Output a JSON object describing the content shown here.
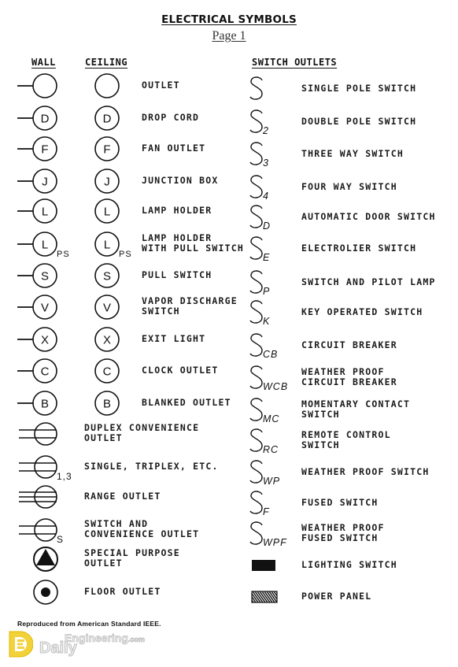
{
  "header": {
    "title": "ELECTRICAL SYMBOLS",
    "subtitle": "Page 1"
  },
  "columns": {
    "wall": "WALL",
    "ceiling": "CEILING",
    "switch_outlets": "SWITCH OUTLETS"
  },
  "outlet_symbols": [
    {
      "letter": "",
      "label": "OUTLET",
      "suffix": ""
    },
    {
      "letter": "D",
      "label": "DROP CORD",
      "suffix": ""
    },
    {
      "letter": "F",
      "label": "FAN OUTLET",
      "suffix": ""
    },
    {
      "letter": "J",
      "label": "JUNCTION BOX",
      "suffix": ""
    },
    {
      "letter": "L",
      "label": "LAMP HOLDER",
      "suffix": ""
    },
    {
      "letter": "L",
      "label": "LAMP HOLDER\nWITH PULL SWITCH",
      "suffix": "PS"
    },
    {
      "letter": "S",
      "label": "PULL SWITCH",
      "suffix": ""
    },
    {
      "letter": "V",
      "label": "VAPOR DISCHARGE\nSWITCH",
      "suffix": ""
    },
    {
      "letter": "X",
      "label": "EXIT LIGHT",
      "suffix": ""
    },
    {
      "letter": "C",
      "label": "CLOCK OUTLET",
      "suffix": ""
    },
    {
      "letter": "B",
      "label": "BLANKED OUTLET",
      "suffix": ""
    }
  ],
  "convenience_symbols": [
    {
      "kind": "duplex",
      "label": "DUPLEX CONVENIENCE\nOUTLET",
      "suffix": ""
    },
    {
      "kind": "single",
      "label": "SINGLE, TRIPLEX, ETC.",
      "suffix": "1,3"
    },
    {
      "kind": "range",
      "label": "RANGE OUTLET",
      "suffix": ""
    },
    {
      "kind": "switch-conv",
      "label": "SWITCH AND\nCONVENIENCE OUTLET",
      "suffix": "S"
    },
    {
      "kind": "special",
      "label": "SPECIAL PURPOSE\nOUTLET",
      "suffix": ""
    },
    {
      "kind": "floor",
      "label": "FLOOR OUTLET",
      "suffix": ""
    }
  ],
  "switch_symbols": [
    {
      "sub": "",
      "label": "SINGLE POLE SWITCH"
    },
    {
      "sub": "2",
      "label": "DOUBLE POLE SWITCH"
    },
    {
      "sub": "3",
      "label": "THREE WAY SWITCH"
    },
    {
      "sub": "4",
      "label": "FOUR WAY SWITCH"
    },
    {
      "sub": "D",
      "label": "AUTOMATIC DOOR SWITCH"
    },
    {
      "sub": "E",
      "label": "ELECTROLIER SWITCH"
    },
    {
      "sub": "P",
      "label": "SWITCH AND PILOT LAMP"
    },
    {
      "sub": "K",
      "label": "KEY OPERATED SWITCH"
    },
    {
      "sub": "CB",
      "label": "CIRCUIT BREAKER"
    },
    {
      "sub": "WCB",
      "label": "WEATHER PROOF\nCIRCUIT BREAKER"
    },
    {
      "sub": "MC",
      "label": "MOMENTARY CONTACT\nSWITCH"
    },
    {
      "sub": "RC",
      "label": "REMOTE CONTROL\nSWITCH"
    },
    {
      "sub": "WP",
      "label": "WEATHER PROOF SWITCH"
    },
    {
      "sub": "F",
      "label": "FUSED SWITCH"
    },
    {
      "sub": "WPF",
      "label": "WEATHER PROOF\nFUSED SWITCH"
    }
  ],
  "panel_symbols": [
    {
      "kind": "solid",
      "label": "LIGHTING SWITCH"
    },
    {
      "kind": "hatched",
      "label": "POWER PANEL"
    }
  ],
  "footer": {
    "note": "Reproduced from American Standard IEEE.",
    "logo_daily": "Daily",
    "logo_engineering": "Engineering",
    "logo_com": ".com"
  },
  "colors": {
    "ink": "#111111",
    "logo_yellow": "#f2d23a",
    "logo_outline": "#bdbdbd"
  }
}
